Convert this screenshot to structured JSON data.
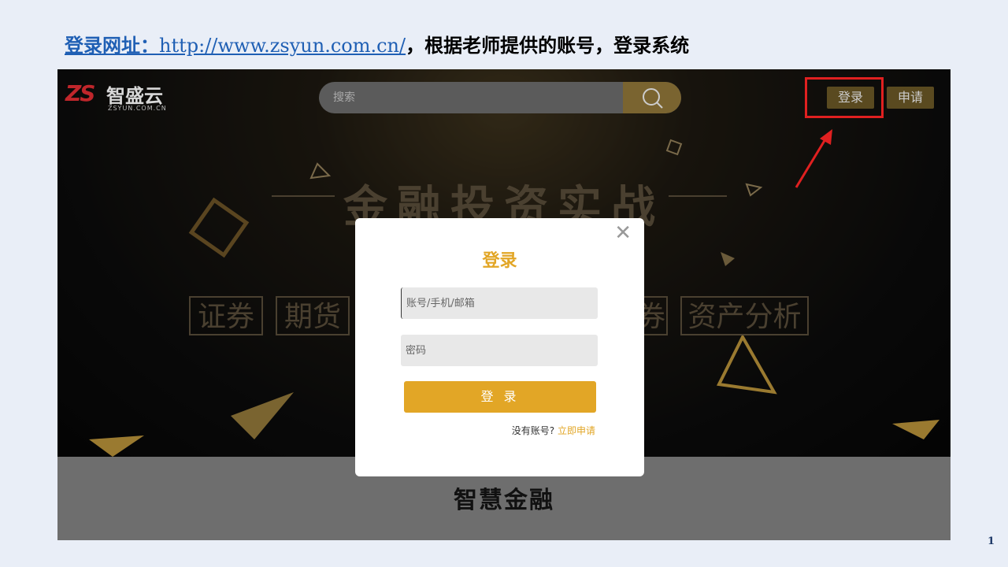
{
  "instruction": {
    "label": "登录网址：",
    "url": "http://www.zsyun.com.cn/",
    "rest": "，根据老师提供的账号，登录系统"
  },
  "site": {
    "logo_mark": "ZS",
    "logo_name": "智盛云",
    "logo_domain": "ZSYUN.COM.CN",
    "search_placeholder": "搜索",
    "nav_login": "登录",
    "nav_apply": "申请"
  },
  "hero": {
    "banner": "金融投资实战",
    "categories": [
      "证券",
      "期货",
      "券",
      "资产分析"
    ]
  },
  "modal": {
    "title": "登录",
    "account_placeholder": "账号/手机/邮箱",
    "password_placeholder": "密码",
    "submit_label": "登 录",
    "no_account_text": "没有账号?",
    "register_link": "立即申请",
    "close_symbol": "✕"
  },
  "lower": {
    "title": "智慧金融"
  },
  "page_number": "1",
  "colors": {
    "accent": "#e2a626",
    "link_blue": "#1f5fb4",
    "highlight_red": "#e02020"
  }
}
